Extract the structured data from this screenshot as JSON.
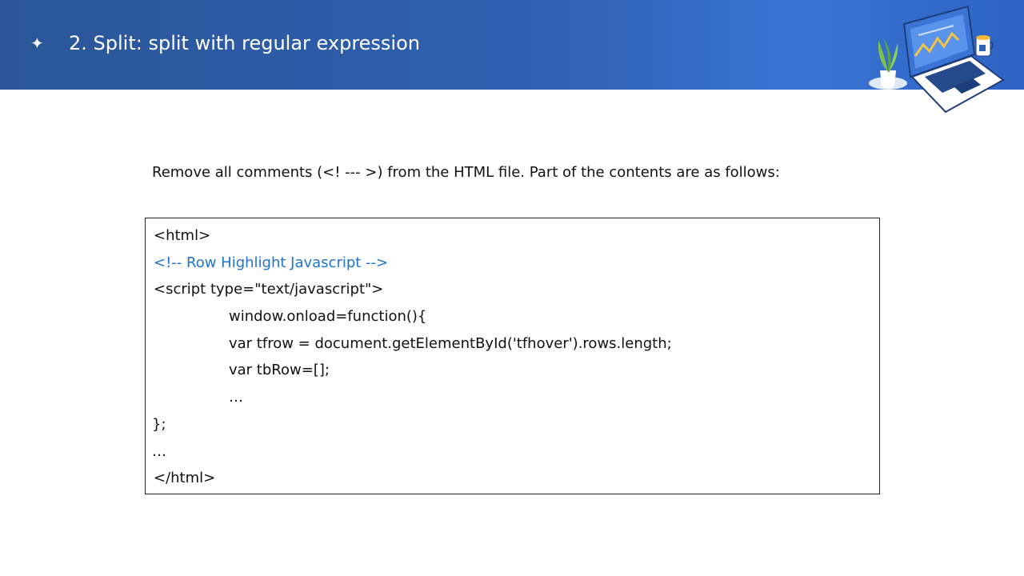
{
  "header": {
    "bullet_icon": "sparkle-icon",
    "title": "2. Split: split with regular expression",
    "illustration_icon": "laptop-desk-illustration-icon"
  },
  "content": {
    "intro": "Remove all comments (<! --- >) from the HTML file. Part of the contents are as follows:",
    "code_lines": [
      "<html>",
      "<!-- Row Highlight Javascript -->",
      "<script type=\"text/javascript\">",
      "window.onload=function(){",
      "var tfrow = document.getElementById('tfhover').rows.length;",
      "var tbRow=[];",
      "…",
      "};",
      "…",
      "</html>"
    ]
  },
  "colors": {
    "header_blue": "#2f62b3",
    "comment_blue": "#1f74c9"
  }
}
